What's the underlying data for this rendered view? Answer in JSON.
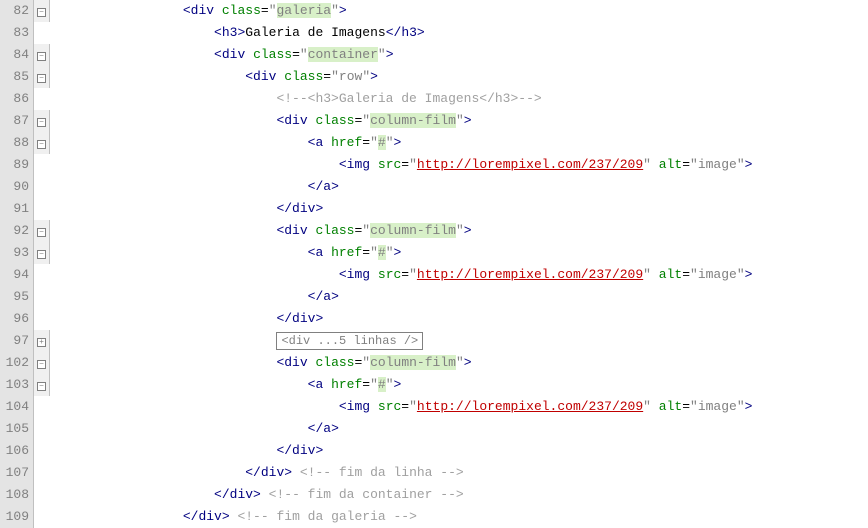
{
  "fold_minus": "−",
  "fold_plus": "+",
  "lines": [
    {
      "n": "82",
      "fold": "minus",
      "indent": "                ",
      "frag": "div_open_galeria"
    },
    {
      "n": "83",
      "fold": "line",
      "indent": "                    ",
      "frag": "h3_galeria"
    },
    {
      "n": "84",
      "fold": "minus",
      "indent": "                    ",
      "frag": "div_open_container"
    },
    {
      "n": "85",
      "fold": "minus",
      "indent": "                        ",
      "frag": "div_open_row"
    },
    {
      "n": "86",
      "fold": "line",
      "indent": "                            ",
      "frag": "comment_h3"
    },
    {
      "n": "87",
      "fold": "minus",
      "indent": "                            ",
      "frag": "div_open_column"
    },
    {
      "n": "88",
      "fold": "minus",
      "indent": "                                ",
      "frag": "a_open"
    },
    {
      "n": "89",
      "fold": "line",
      "indent": "                                    ",
      "frag": "img"
    },
    {
      "n": "90",
      "fold": "line",
      "indent": "                                ",
      "frag": "a_close"
    },
    {
      "n": "91",
      "fold": "line",
      "indent": "                            ",
      "frag": "div_close"
    },
    {
      "n": "92",
      "fold": "minus",
      "indent": "                            ",
      "frag": "div_open_column"
    },
    {
      "n": "93",
      "fold": "minus",
      "indent": "                                ",
      "frag": "a_open"
    },
    {
      "n": "94",
      "fold": "line",
      "indent": "                                    ",
      "frag": "img"
    },
    {
      "n": "95",
      "fold": "line",
      "indent": "                                ",
      "frag": "a_close"
    },
    {
      "n": "96",
      "fold": "line",
      "indent": "                            ",
      "frag": "div_close"
    },
    {
      "n": "97",
      "fold": "plus",
      "indent": "                            ",
      "frag": "collapsed"
    },
    {
      "n": "102",
      "fold": "minus",
      "indent": "                            ",
      "frag": "div_open_column"
    },
    {
      "n": "103",
      "fold": "minus",
      "indent": "                                ",
      "frag": "a_open"
    },
    {
      "n": "104",
      "fold": "line",
      "indent": "                                    ",
      "frag": "img"
    },
    {
      "n": "105",
      "fold": "line",
      "indent": "                                ",
      "frag": "a_close"
    },
    {
      "n": "106",
      "fold": "line",
      "indent": "                            ",
      "frag": "div_close"
    },
    {
      "n": "107",
      "fold": "line",
      "indent": "                        ",
      "frag": "div_close_c1"
    },
    {
      "n": "108",
      "fold": "line",
      "indent": "                    ",
      "frag": "div_close_c2"
    },
    {
      "n": "109",
      "fold": "line",
      "indent": "                ",
      "frag": "div_close_c3"
    }
  ],
  "t": {
    "lt": "<",
    "gt": ">",
    "slash": "/",
    "div": "div",
    "h3": "h3",
    "a": "a",
    "img": "img",
    "class_attr": "class",
    "href_attr": "href",
    "src_attr": "src",
    "alt_attr": "alt",
    "q": "\"",
    "eq": "=",
    "sp": " ",
    "val_galeria": "galeria",
    "val_container": "container",
    "val_row": "row",
    "val_column": "column-film",
    "val_href": "#",
    "val_src": "http://lorempixel.com/237/209",
    "val_alt": "image",
    "h3_text": "Galeria de Imagens",
    "comment_h3": "<!--<h3>Galeria de Imagens</h3>-->",
    "collapsed": "<div ...5 linhas />",
    "comment_c1": " <!-- fim da linha -->",
    "comment_c2": " <!-- fim da container -->",
    "comment_c3": " <!-- fim da galeria -->"
  }
}
